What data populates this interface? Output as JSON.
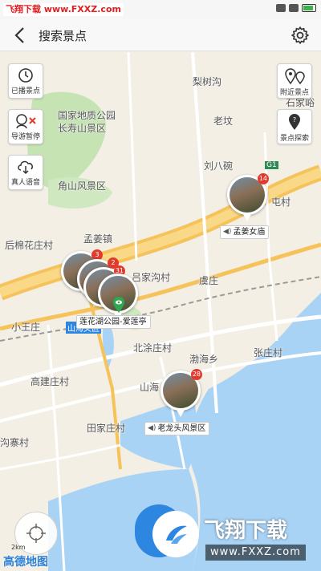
{
  "status_bar": {
    "watermark": "飞翔下载 www.FXXZ.com"
  },
  "header": {
    "title": "搜索景点",
    "back_icon": "back-arrow-icon",
    "settings_icon": "gear-icon"
  },
  "map_places": [
    {
      "text": "梨树沟"
    },
    {
      "text": "国家地质公园"
    },
    {
      "text": "长寿山景区"
    },
    {
      "text": "老坟"
    },
    {
      "text": "刘八碗"
    },
    {
      "text": "石家峪"
    },
    {
      "text": "角山风景区"
    },
    {
      "text": "屯村"
    },
    {
      "text": "后棉花庄村"
    },
    {
      "text": "孟姜镇"
    },
    {
      "text": "吕家沟村"
    },
    {
      "text": "虞庄"
    },
    {
      "text": "小王庄"
    },
    {
      "text": "北涂庄村"
    },
    {
      "text": "渤海乡"
    },
    {
      "text": "张庄村"
    },
    {
      "text": "高建庄村"
    },
    {
      "text": "山海"
    },
    {
      "text": "田家庄村"
    },
    {
      "text": "沟寨村"
    },
    {
      "text": "山海关区"
    },
    {
      "text": "G1"
    }
  ],
  "left_buttons": [
    {
      "label": "已播景点",
      "icon": "history-clock-icon"
    },
    {
      "label": "导游暂停",
      "icon": "guide-pause-icon"
    },
    {
      "label": "真人语音",
      "icon": "cloud-voice-icon"
    }
  ],
  "right_buttons": [
    {
      "label": "附近景点",
      "icon": "nearby-pins-icon"
    },
    {
      "label": "景点探索",
      "icon": "explore-pin-icon"
    }
  ],
  "spots": [
    {
      "label": "孟姜女庙",
      "badge": "14"
    },
    {
      "label": "莲花湖公园-爱莲亭",
      "badge": "2"
    },
    {
      "label": "老龙头风景区",
      "badge": "28"
    }
  ],
  "cluster_badges": [
    "3",
    "31"
  ],
  "map_brand": "高德地图",
  "scale_text": "2km",
  "watermark_logo": {
    "text": "飞翔下载",
    "url": "www.FXXZ.com"
  },
  "colors": {
    "water": "#a9d3f5",
    "road_major": "#f6c35a",
    "green": "#c6e3b4",
    "marker_badge": "#e23b2e",
    "accent_blue": "#2d87e0"
  }
}
